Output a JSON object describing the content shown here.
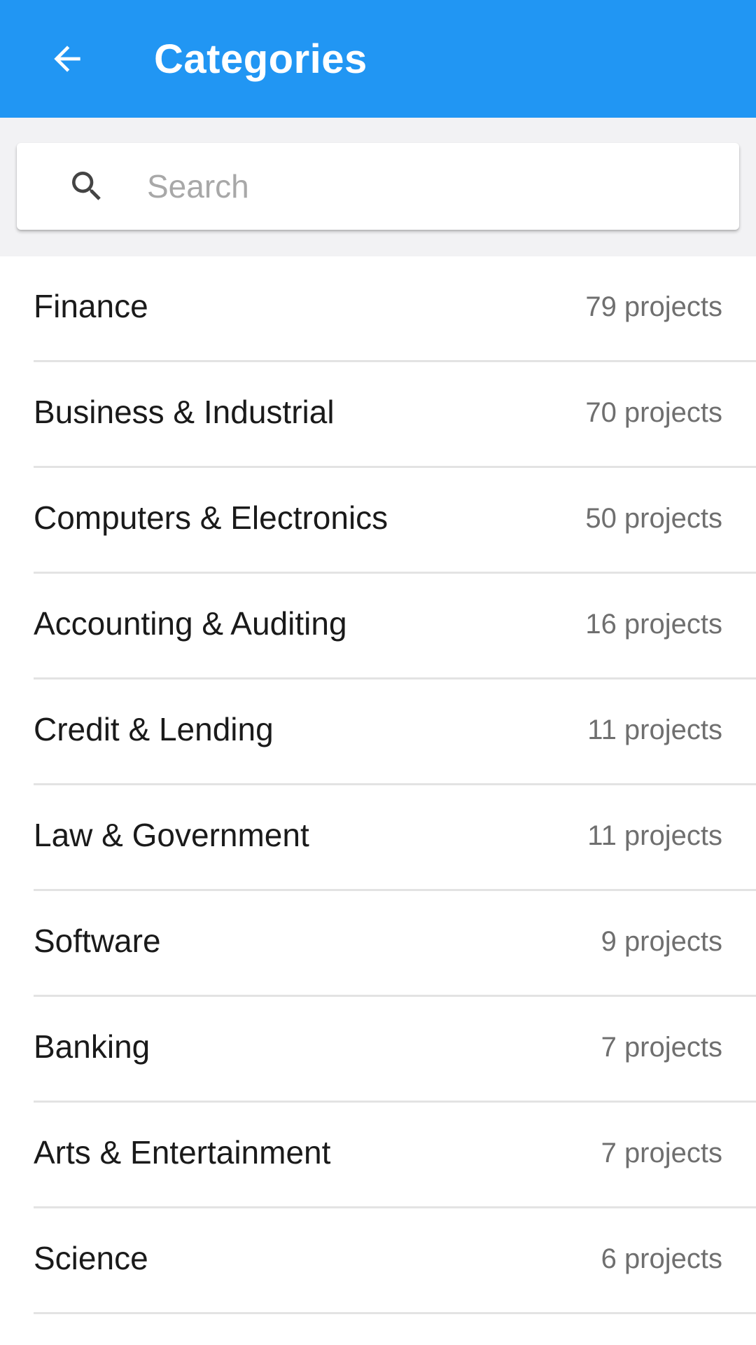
{
  "appbar": {
    "title": "Categories",
    "back_icon": "arrow-left-icon",
    "color": "#2196F3"
  },
  "search": {
    "placeholder": "Search",
    "value": "",
    "icon": "search-icon"
  },
  "categories": [
    {
      "label": "Finance",
      "count": "79 projects"
    },
    {
      "label": "Business & Industrial",
      "count": "70 projects"
    },
    {
      "label": "Computers & Electronics",
      "count": "50 projects"
    },
    {
      "label": "Accounting & Auditing",
      "count": "16 projects"
    },
    {
      "label": "Credit & Lending",
      "count": "11 projects"
    },
    {
      "label": "Law & Government",
      "count": "11 projects"
    },
    {
      "label": "Software",
      "count": "9 projects"
    },
    {
      "label": "Banking",
      "count": "7 projects"
    },
    {
      "label": "Arts & Entertainment",
      "count": "7 projects"
    },
    {
      "label": "Science",
      "count": "6 projects"
    }
  ]
}
